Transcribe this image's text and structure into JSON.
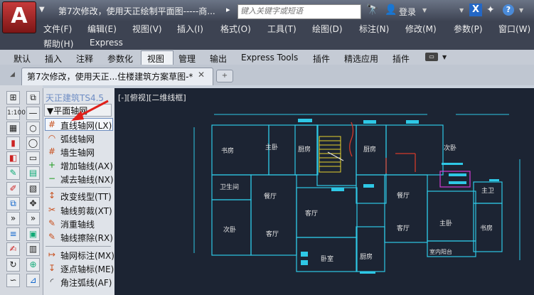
{
  "titlebar": {
    "app_letter": "A",
    "title": "第7次修改，使用天正绘制平面图-----商...",
    "more_arrow": "▸",
    "search_placeholder": "键入关键字或短语",
    "login_label": "登录",
    "x_label": "X"
  },
  "menubar": {
    "row1": [
      "文件(F)",
      "编辑(E)",
      "视图(V)",
      "插入(I)",
      "格式(O)",
      "工具(T)",
      "绘图(D)",
      "标注(N)",
      "修改(M)",
      "参数(P)",
      "窗口(W)"
    ],
    "row2": [
      "帮助(H)",
      "Express"
    ]
  },
  "ribbon": {
    "tabs": [
      "默认",
      "插入",
      "注释",
      "参数化",
      "视图",
      "管理",
      "输出",
      "Express Tools",
      "插件",
      "精选应用",
      "插件"
    ],
    "active_tab": "视图"
  },
  "document": {
    "tab_label": "第7次修改，使用天正...住楼建筑方案草图-*",
    "close_glyph": "✕"
  },
  "palette": {
    "title": "天正建筑TS4.5",
    "group_label": "▼平面轴网",
    "items": [
      {
        "icon": "#",
        "label": "直线轴网(LX)",
        "color": "#c8501e"
      },
      {
        "icon": "◠",
        "label": "弧线轴网",
        "color": "#c8501e"
      },
      {
        "icon": "#",
        "label": "墙生轴网",
        "color": "#c8501e"
      },
      {
        "icon": "+",
        "label": "增加轴线(AX)",
        "color": "#1b9a1b"
      },
      {
        "icon": "−",
        "label": "减去轴线(NX)",
        "color": "#1b9a1b"
      },
      {
        "icon": "↕",
        "label": "改变线型(TT)",
        "color": "#c8501e"
      },
      {
        "icon": "✂",
        "label": "轴线剪裁(XT)",
        "color": "#c8501e"
      },
      {
        "icon": "✎",
        "label": "消重轴线",
        "color": "#c8501e"
      },
      {
        "icon": "✎",
        "label": "轴线擦除(RX)",
        "color": "#c8501e"
      },
      {
        "icon": "↦",
        "label": "轴网标注(MX)",
        "color": "#c8501e"
      },
      {
        "icon": "↧",
        "label": "逐点轴标(ME)",
        "color": "#c8501e"
      },
      {
        "icon": "◜",
        "label": "角注弧线(AF)",
        "color": "#333"
      }
    ]
  },
  "canvas": {
    "view_label": "[-][俯视][二维线框]",
    "rooms": [
      "书房",
      "主卧",
      "厨房",
      "厨房",
      "次卧",
      "卫生间",
      "餐厅",
      "餐厅",
      "主卫",
      "客厅",
      "客厅",
      "次卧",
      "客厅",
      "卧室",
      "厨房",
      "主卧",
      "书房",
      "室内阳台"
    ]
  },
  "colors": {
    "canvas_bg": "#1c2433",
    "wall_line": "#2ec8e6",
    "accent_red": "#d23a2a",
    "stair_yellow": "#e6d22e",
    "magenta": "#d43ad4"
  }
}
